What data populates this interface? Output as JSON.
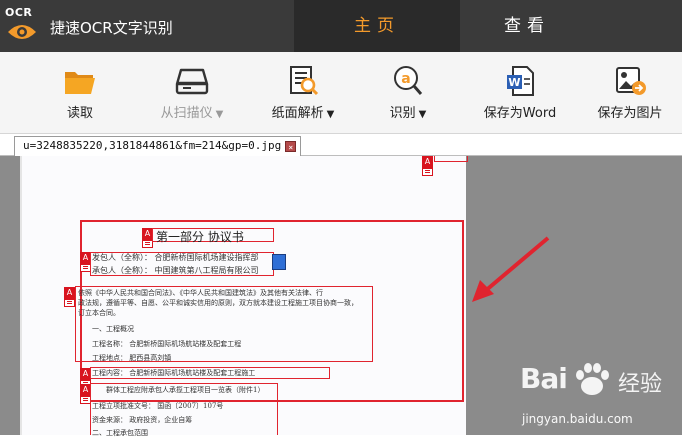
{
  "app": {
    "logo_text": "OCR",
    "title": "捷速OCR文字识别"
  },
  "nav": {
    "home": "主页",
    "view": "查看"
  },
  "toolbar": {
    "read": "读取",
    "scan": "从扫描仪",
    "parse": "纸面解析",
    "recognize": "识别",
    "save_word": "保存为Word",
    "save_image": "保存为图片"
  },
  "tab": {
    "filename": "u=3248835220,3181844861&fm=214&gp=0.jpg"
  },
  "document": {
    "heading": "第一部分      协议书",
    "lines": [
      "发包人（全称）：   合肥新桥国际机场建设指挥部",
      "承包人（全称）：   中国建筑第八工程局有限公司",
      "依照《中华人民共和国合同法》、《中华人民共和国建筑法》及其他有关法律、行",
      "政法规，遵循平等、自愿、公平和诚实信用的原则，双方就本建设工程施工项目协商一致，",
      "订立本合同。",
      "一、工程概况",
      "工程名称：  合肥新桥国际机场航站楼及配套工程",
      "工程地点：  肥西县高刘镇",
      "工程内容：  合肥新桥国际机场航站楼及配套工程施工",
      "群体工程应附承包人承揽工程项目一览表（附件1）",
      "工程立项批准文号：  国函〔2007〕107号",
      "资金来源：  政府投资，企业自筹",
      "二、工程承包范围"
    ]
  },
  "watermark": {
    "brand": "Bai",
    "tail": "经验",
    "url": "jingyan.baidu.com"
  },
  "colors": {
    "accent": "#f39a2b",
    "annotation": "#e0242f",
    "titlebar": "#3a3a3a"
  }
}
